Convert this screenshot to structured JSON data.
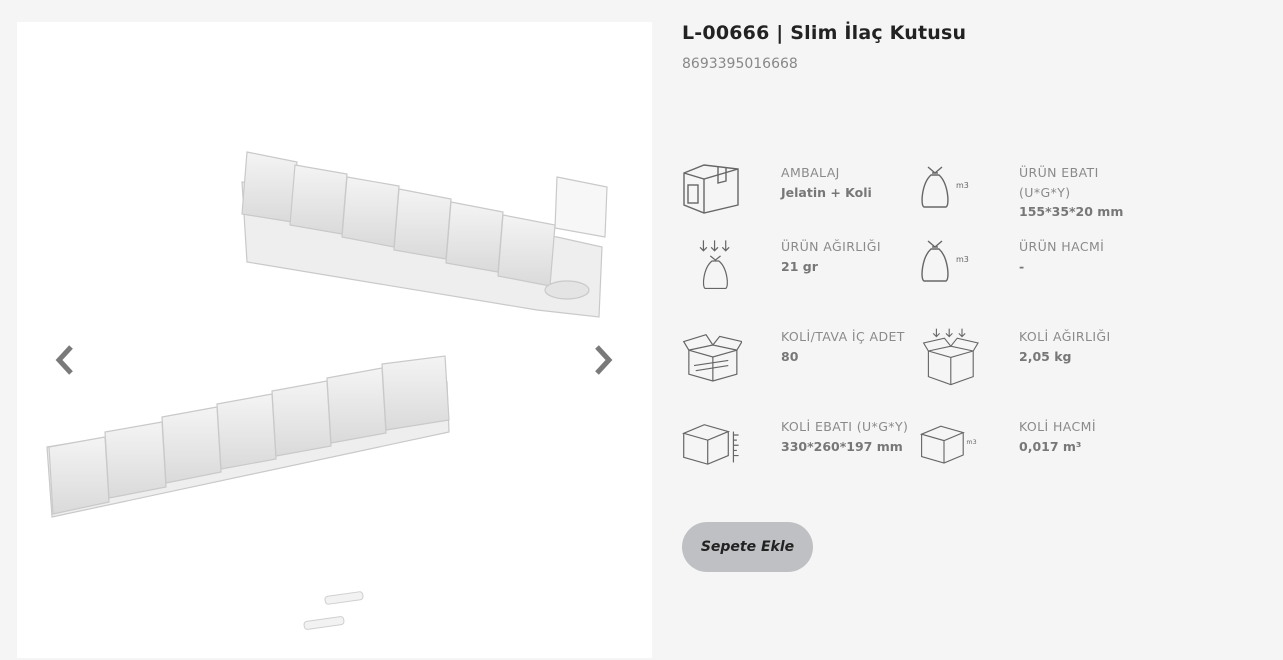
{
  "product": {
    "title": "L-00666 | Slim İlaç Kutusu",
    "barcode": "8693395016668"
  },
  "gallery": {
    "prev_icon": "chevron-left-icon",
    "next_icon": "chevron-right-icon"
  },
  "specs": {
    "ambalaj": {
      "label": "AMBALAJ",
      "value": "Jelatin + Koli",
      "icon": "package-icon"
    },
    "urun_ebati": {
      "label": "ÜRÜN EBATI (U*G*Y)",
      "value": "155*35*20 mm",
      "icon": "bag-volume-icon"
    },
    "urun_agirligi": {
      "label": "ÜRÜN AĞIRLIĞI",
      "value": "21 gr",
      "icon": "bag-weight-icon"
    },
    "urun_hacmi": {
      "label": "ÜRÜN HACMİ",
      "value": "-",
      "icon": "bag-volume-icon"
    },
    "koli_ic_adet": {
      "label": "KOLİ/TAVA İÇ ADET",
      "value": "80",
      "icon": "open-box-icon"
    },
    "koli_agirligi": {
      "label": "KOLİ AĞIRLIĞI",
      "value": "2,05 kg",
      "icon": "box-weight-icon"
    },
    "koli_ebati": {
      "label": "KOLİ EBATI (U*G*Y)",
      "value": "330*260*197 mm",
      "icon": "box-dimensions-icon"
    },
    "koli_hacmi": {
      "label": "KOLİ HACMİ",
      "value": "0,017 m³",
      "icon": "box-volume-icon"
    }
  },
  "icon_text": {
    "m3": "m3"
  },
  "cart": {
    "label": "Sepete Ekle"
  }
}
